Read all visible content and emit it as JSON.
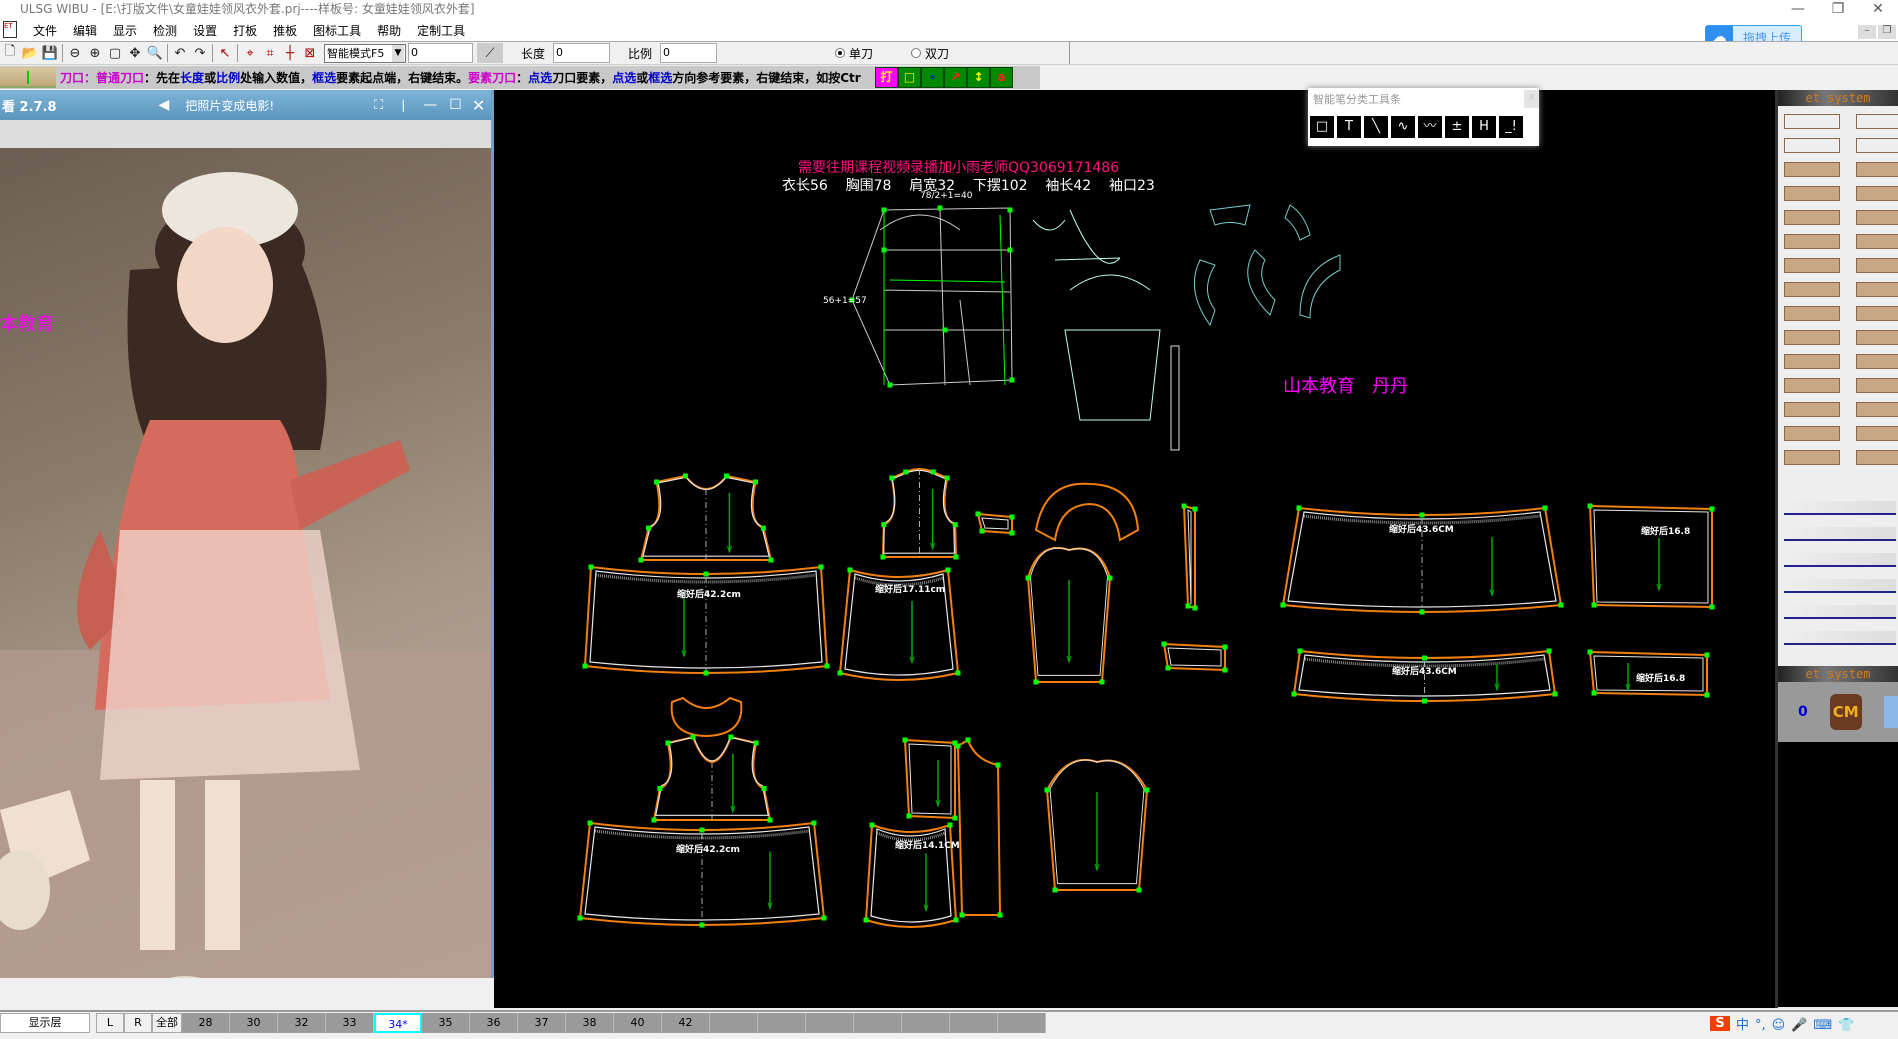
{
  "window": {
    "title": "ULSG WIBU - [E:\\打版文件\\女童娃娃领风衣外套.prj----样板号: 女童娃娃领风衣外套]",
    "minimize": "—",
    "restore": "❐",
    "close": "✕"
  },
  "menu": [
    "文件",
    "编辑",
    "显示",
    "检测",
    "设置",
    "打板",
    "推板",
    "图标工具",
    "帮助",
    "定制工具"
  ],
  "upload": {
    "label": "拖拽上传",
    "icon": "cloud-icon"
  },
  "toolbar": {
    "icons": [
      "new-file-icon",
      "open-folder-icon",
      "save-icon",
      "zoom-out-icon",
      "zoom-in-icon",
      "fit-view-icon",
      "pan-icon",
      "zoom-window-icon",
      "undo-icon",
      "redo-icon",
      "select-delete-icon",
      "node-tool-1-icon",
      "node-tool-2-icon",
      "node-tool-3-icon",
      "node-tool-4-icon"
    ],
    "mode": "智能模式F5",
    "mode_value": "0",
    "length_label": "长度",
    "length_value": "0",
    "ratio_label": "比例",
    "ratio_value": "0",
    "radio_single": "单刀",
    "radio_double": "双刀",
    "selected": "单刀"
  },
  "hint": {
    "segments": [
      {
        "t": "刀口：",
        "c": "m"
      },
      {
        "t": "普通刀口",
        "c": "m"
      },
      {
        "t": "：先在",
        "c": "k"
      },
      {
        "t": "长度",
        "c": "b"
      },
      {
        "t": "或",
        "c": "k"
      },
      {
        "t": "比例",
        "c": "b"
      },
      {
        "t": "处输入数值，",
        "c": "k"
      },
      {
        "t": "框选",
        "c": "b"
      },
      {
        "t": "要素起点端，右键结束。",
        "c": "k"
      },
      {
        "t": "要素刀口",
        "c": "m"
      },
      {
        "t": "：",
        "c": "k"
      },
      {
        "t": "点选",
        "c": "b"
      },
      {
        "t": "刀口要素，",
        "c": "k"
      },
      {
        "t": "点选",
        "c": "b"
      },
      {
        "t": "或",
        "c": "k"
      },
      {
        "t": "框选",
        "c": "b"
      },
      {
        "t": "方向参考要素，右键结束，如按Ctr",
        "c": "k"
      }
    ],
    "buttons": [
      "打",
      "□",
      "∘",
      "↗",
      "↕",
      "a"
    ]
  },
  "float_toolbar": {
    "title": "智能笔分类工具条",
    "close": "x",
    "icons": [
      "rectangle-icon",
      "t-square-icon",
      "line-icon",
      "curve-icon",
      "smart-curve-icon",
      "offset-icon",
      "parallel-icon",
      "corner-icon"
    ]
  },
  "video": {
    "app_title": "看 2.7.8",
    "slogan": "把照片变成电影!",
    "watermark": "本教育"
  },
  "canvas": {
    "notice": "需要往期课程视频录播加小雨老师QQ3069171486",
    "measurements": "衣长56    胸围78    肩宽32    下摆102    袖长42    袖口23",
    "formula": "78/2+1=40",
    "side_label": "56+1=57",
    "author": "山本教育   丹丹",
    "labels": {
      "skirt1": "缩好后42.2cm",
      "skirt2": "缩好后17.11cm",
      "band1": "缩好后43.6CM",
      "band2": "缩好后16.8",
      "band3": "缩好后43.6CM",
      "band4": "缩好后16.8",
      "skirt3": "缩好后42.2cm",
      "skirt4": "缩好后14.1CM"
    },
    "colors": {
      "outline": "#f08010",
      "inner": "#e8e8e8",
      "point": "#00ff00",
      "grain": "#00aa00",
      "notice": "#ff1080",
      "author": "#ff00ff"
    }
  },
  "right_panel": {
    "header": "et system",
    "footer": "et system",
    "value": "0",
    "unit": "CM"
  },
  "bottom": {
    "layer_label": "显示层",
    "l": "L",
    "r": "R",
    "all": "全部",
    "sizes": [
      "28",
      "30",
      "32",
      "33",
      "34*",
      "35",
      "36",
      "37",
      "38",
      "40",
      "42",
      "",
      "",
      "",
      "",
      "",
      "",
      ""
    ],
    "active_size": "34*"
  },
  "tray": [
    "中",
    "°,",
    "☺",
    "🎤",
    "⌨",
    "👕"
  ]
}
